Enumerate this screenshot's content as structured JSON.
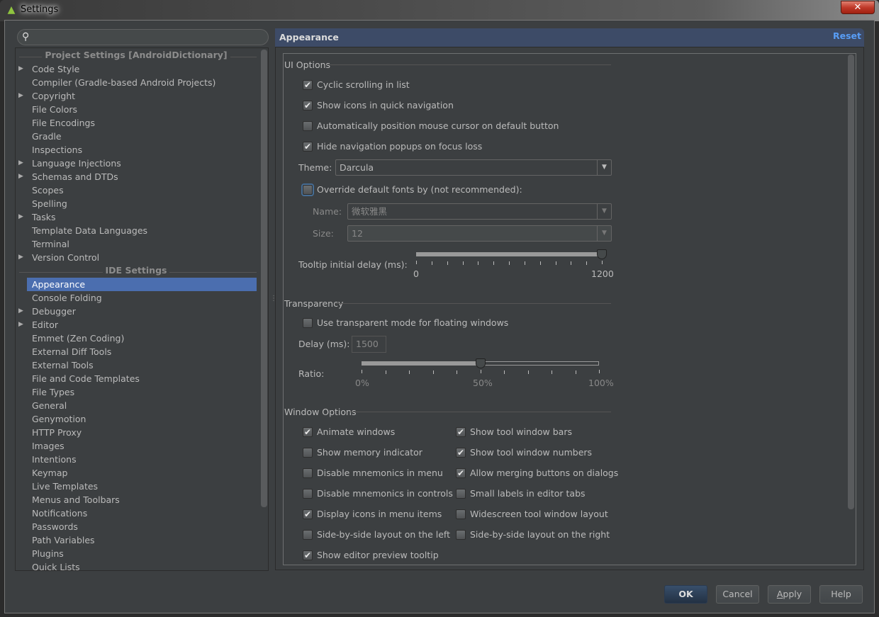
{
  "window": {
    "title": "Settings",
    "close_icon": "close-icon"
  },
  "search": {
    "placeholder": ""
  },
  "tree": {
    "project_header": "Project Settings [AndroidDictionary]",
    "project_items": [
      {
        "label": "Code Style",
        "expandable": true
      },
      {
        "label": "Compiler (Gradle-based Android Projects)",
        "expandable": false
      },
      {
        "label": "Copyright",
        "expandable": true
      },
      {
        "label": "File Colors",
        "expandable": false
      },
      {
        "label": "File Encodings",
        "expandable": false
      },
      {
        "label": "Gradle",
        "expandable": false
      },
      {
        "label": "Inspections",
        "expandable": false
      },
      {
        "label": "Language Injections",
        "expandable": true
      },
      {
        "label": "Schemas and DTDs",
        "expandable": true
      },
      {
        "label": "Scopes",
        "expandable": false
      },
      {
        "label": "Spelling",
        "expandable": false
      },
      {
        "label": "Tasks",
        "expandable": true
      },
      {
        "label": "Template Data Languages",
        "expandable": false
      },
      {
        "label": "Terminal",
        "expandable": false
      },
      {
        "label": "Version Control",
        "expandable": true
      }
    ],
    "ide_header": "IDE Settings",
    "ide_items": [
      {
        "label": "Appearance",
        "expandable": false,
        "selected": true
      },
      {
        "label": "Console Folding",
        "expandable": false
      },
      {
        "label": "Debugger",
        "expandable": true
      },
      {
        "label": "Editor",
        "expandable": true
      },
      {
        "label": "Emmet (Zen Coding)",
        "expandable": false
      },
      {
        "label": "External Diff Tools",
        "expandable": false
      },
      {
        "label": "External Tools",
        "expandable": false
      },
      {
        "label": "File and Code Templates",
        "expandable": false
      },
      {
        "label": "File Types",
        "expandable": false
      },
      {
        "label": "General",
        "expandable": false
      },
      {
        "label": "Genymotion",
        "expandable": false
      },
      {
        "label": "HTTP Proxy",
        "expandable": false
      },
      {
        "label": "Images",
        "expandable": false
      },
      {
        "label": "Intentions",
        "expandable": false
      },
      {
        "label": "Keymap",
        "expandable": false
      },
      {
        "label": "Live Templates",
        "expandable": false
      },
      {
        "label": "Menus and Toolbars",
        "expandable": false
      },
      {
        "label": "Notifications",
        "expandable": false
      },
      {
        "label": "Passwords",
        "expandable": false
      },
      {
        "label": "Path Variables",
        "expandable": false
      },
      {
        "label": "Plugins",
        "expandable": false
      },
      {
        "label": "Quick Lists",
        "expandable": false
      }
    ]
  },
  "panel": {
    "title": "Appearance",
    "reset": "Reset",
    "ui_options": {
      "header": "UI Options",
      "checks": [
        {
          "label": "Cyclic scrolling in list",
          "checked": true
        },
        {
          "label": "Show icons in quick navigation",
          "checked": true
        },
        {
          "label": "Automatically position mouse cursor on default button",
          "checked": false
        },
        {
          "label": "Hide navigation popups on focus loss",
          "checked": true
        }
      ],
      "theme_label": "Theme:",
      "theme_value": "Darcula",
      "override_label": "Override default fonts by (not recommended):",
      "override_checked": false,
      "name_label": "Name:",
      "name_value": "微软雅黑",
      "size_label": "Size:",
      "size_value": "12",
      "tooltip_label": "Tooltip initial delay (ms):",
      "tooltip_min": "0",
      "tooltip_max": "1200",
      "tooltip_value": 1200
    },
    "transparency": {
      "header": "Transparency",
      "use_label": "Use transparent mode for floating windows",
      "use_checked": false,
      "delay_label": "Delay (ms):",
      "delay_value": "1500",
      "ratio_label": "Ratio:",
      "ratio_ticks": [
        "0%",
        "50%",
        "100%"
      ],
      "ratio_value": 50
    },
    "window_options": {
      "header": "Window Options",
      "left": [
        {
          "label": "Animate windows",
          "checked": true
        },
        {
          "label": "Show memory indicator",
          "checked": false
        },
        {
          "label": "Disable mnemonics in menu",
          "checked": false
        },
        {
          "label": "Disable mnemonics in controls",
          "checked": false
        },
        {
          "label": "Display icons in menu items",
          "checked": true
        },
        {
          "label": "Side-by-side layout on the left",
          "checked": false
        },
        {
          "label": "Show editor preview tooltip",
          "checked": true
        }
      ],
      "right": [
        {
          "label": "Show tool window bars",
          "checked": true
        },
        {
          "label": "Show tool window numbers",
          "checked": true
        },
        {
          "label": "Allow merging buttons on dialogs",
          "checked": true
        },
        {
          "label": "Small labels in editor tabs",
          "checked": false
        },
        {
          "label": "Widescreen tool window layout",
          "checked": false
        },
        {
          "label": "Side-by-side layout on the right",
          "checked": false
        }
      ]
    }
  },
  "buttons": {
    "ok": "OK",
    "cancel": "Cancel",
    "apply": "Apply",
    "help": "Help"
  }
}
